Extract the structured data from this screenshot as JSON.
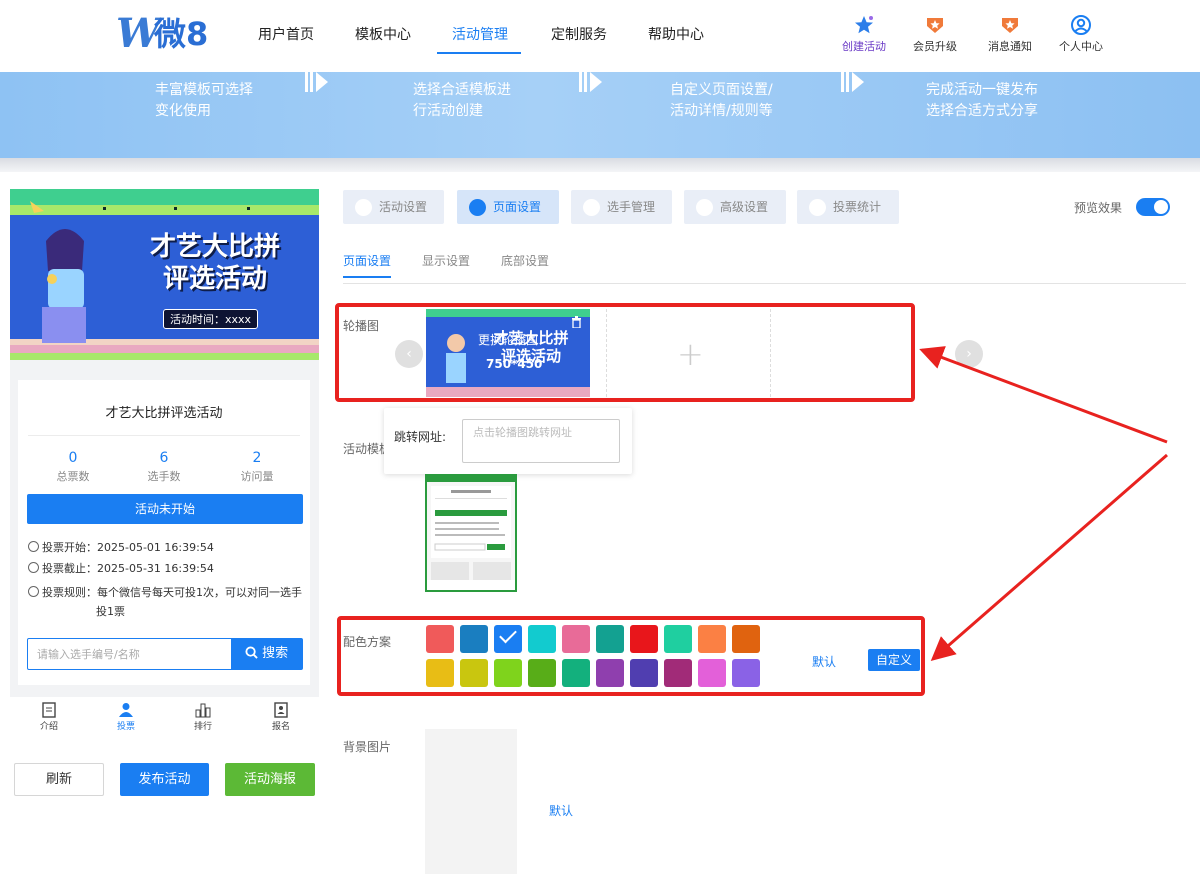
{
  "header": {
    "logo_text": "微8",
    "nav": [
      "用户首页",
      "模板中心",
      "活动管理",
      "定制服务",
      "帮助中心"
    ],
    "actions": {
      "create": "创建活动",
      "vip": "会员升级",
      "notify": "消息通知",
      "account": "个人中心"
    }
  },
  "banner": {
    "steps": [
      [
        "丰富模板可选择",
        "变化使用"
      ],
      [
        "选择合适模板进",
        "行活动创建"
      ],
      [
        "自定义页面设置/",
        "活动详情/规则等"
      ],
      [
        "完成活动一键发布",
        "选择合适方式分享"
      ]
    ]
  },
  "poster": {
    "title_line1": "才艺大比拼",
    "title_line2": "评选活动",
    "time_label": "活动时间：xxxx"
  },
  "preview": {
    "title": "才艺大比拼评选活动",
    "stats": [
      {
        "value": "0",
        "label": "总票数"
      },
      {
        "value": "6",
        "label": "选手数"
      },
      {
        "value": "2",
        "label": "访问量"
      }
    ],
    "status_button": "活动未开始",
    "vote_start": "投票开始：2025-05-01 16:39:54",
    "vote_end": "投票截止：2025-05-31 16:39:54",
    "vote_rule_1": "投票规则：每个微信号每天可投1次，可以对同一选手",
    "vote_rule_2": "投1票",
    "search_placeholder": "请输入选手编号/名称",
    "search_button": "搜索",
    "tabs": [
      "介绍",
      "投票",
      "排行",
      "报名"
    ]
  },
  "bottom_buttons": {
    "refresh": "刷新",
    "publish": "发布活动",
    "poster": "活动海报"
  },
  "editor": {
    "section_tabs": [
      "活动设置",
      "页面设置",
      "选手管理",
      "高级设置",
      "投票统计"
    ],
    "preview_label": "预览效果",
    "preview_enabled": true,
    "sub_tabs": [
      "页面设置",
      "显示设置",
      "底部设置"
    ],
    "carousel_label": "轮播图",
    "carousel_overlay": "更换轮播图",
    "carousel_size": "750*450",
    "link_label": "跳转网址:",
    "link_placeholder": "点击轮播图跳转网址",
    "template_label": "活动模板",
    "color_label": "配色方案",
    "colors_row1": [
      "#f05a5a",
      "#1a7ec0",
      "#1a7ef2",
      "#12cbcf",
      "#e86b98",
      "#13a191",
      "#e8161b",
      "#1fcfa0",
      "#fb8044",
      "#e0630f"
    ],
    "colors_row2": [
      "#e8bd15",
      "#c9c60f",
      "#7fd31c",
      "#58ad18",
      "#13b07d",
      "#8f3fae",
      "#503eb0",
      "#a12b78",
      "#e360d9",
      "#8a62e6"
    ],
    "selected_color": "#1a7ef2",
    "default_label": "默认",
    "custom_label": "自定义",
    "bg_label": "背景图片",
    "bg_default": "默认"
  }
}
